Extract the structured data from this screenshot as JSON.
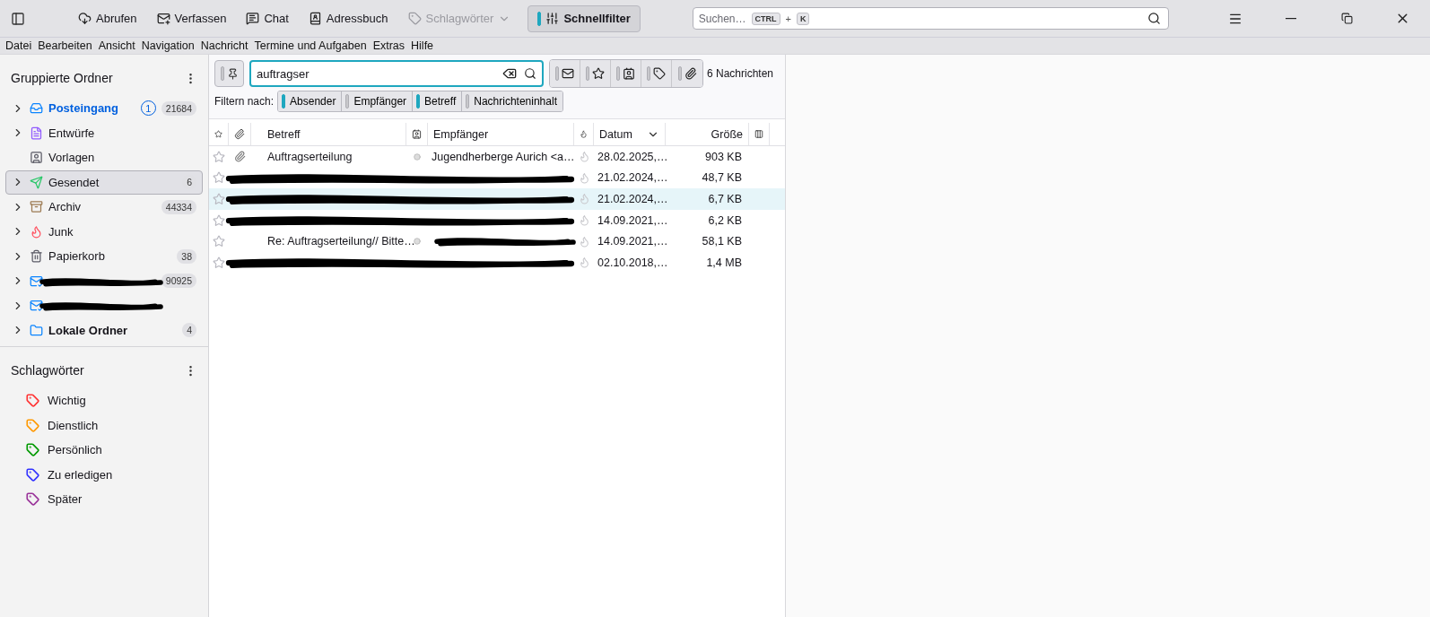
{
  "toolbar": {
    "buttons": [
      {
        "kind": "get",
        "label": "Abrufen",
        "selected": false,
        "disabled": false
      },
      {
        "kind": "write",
        "label": "Verfassen",
        "selected": false,
        "disabled": false
      },
      {
        "kind": "chat",
        "label": "Chat",
        "selected": false,
        "disabled": false
      },
      {
        "kind": "addressbook",
        "label": "Adressbuch",
        "selected": false,
        "disabled": false
      },
      {
        "kind": "tags",
        "label": "Schlagwörter",
        "selected": false,
        "disabled": true
      },
      {
        "kind": "quickfilter",
        "label": "Schnellfilter",
        "selected": true,
        "disabled": false
      }
    ],
    "search": {
      "placeholder": "Suchen…",
      "keys": [
        "CTRL",
        "+",
        "K"
      ]
    }
  },
  "menu_bar": [
    "Datei",
    "Bearbeiten",
    "Ansicht",
    "Navigation",
    "Nachricht",
    "Termine und Aufgaben",
    "Extras",
    "Hilfe"
  ],
  "folder_pane": {
    "title": "Gruppierte Ordner",
    "folders": [
      {
        "kind": "inbox",
        "name": "Posteingang",
        "redacted": false,
        "expandable": true,
        "selected": false,
        "unread": "1",
        "count": "21684"
      },
      {
        "kind": "drafts",
        "name": "Entwürfe",
        "redacted": false,
        "expandable": true,
        "selected": false
      },
      {
        "kind": "templates",
        "name": "Vorlagen",
        "redacted": false,
        "expandable": false,
        "selected": false
      },
      {
        "kind": "sent",
        "name": "Gesendet",
        "redacted": false,
        "expandable": true,
        "selected": true,
        "count": "6"
      },
      {
        "kind": "archive",
        "name": "Archiv",
        "redacted": false,
        "expandable": true,
        "selected": false,
        "count": "44334"
      },
      {
        "kind": "junk",
        "name": "Junk",
        "redacted": false,
        "expandable": true,
        "selected": false
      },
      {
        "kind": "trash",
        "name": "Papierkorb",
        "redacted": false,
        "expandable": true,
        "selected": false,
        "count": "38"
      },
      {
        "kind": "account",
        "redacted": true,
        "expandable": true,
        "selected": false,
        "count": "90925"
      },
      {
        "kind": "account",
        "redacted": true,
        "expandable": true,
        "selected": false
      },
      {
        "kind": "local",
        "name": "Lokale Ordner",
        "redacted": false,
        "expandable": true,
        "selected": false,
        "count": "4"
      }
    ],
    "tags_title": "Schlagwörter",
    "tags": [
      {
        "name": "Wichtig",
        "color": "#ff3333"
      },
      {
        "name": "Dienstlich",
        "color": "#ff9900"
      },
      {
        "name": "Persönlich",
        "color": "#009900"
      },
      {
        "name": "Zu erledigen",
        "color": "#3333ff"
      },
      {
        "name": "Später",
        "color": "#993399"
      }
    ]
  },
  "quick_filter": {
    "pinned": false,
    "value": "auftragser",
    "toggles": [
      {
        "kind": "unread",
        "on": false
      },
      {
        "kind": "starred",
        "on": false
      },
      {
        "kind": "contact",
        "on": false
      },
      {
        "kind": "tags",
        "on": false
      },
      {
        "kind": "attachment",
        "on": false
      }
    ],
    "count": "6 Nachrichten",
    "filter_label": "Filtern nach:",
    "filter_by": [
      {
        "label": "Absender",
        "on": true
      },
      {
        "label": "Empfänger",
        "on": false
      },
      {
        "label": "Betreff",
        "on": true
      },
      {
        "label": "Nachrichteninhalt",
        "on": false
      }
    ]
  },
  "table": {
    "columns": [
      {
        "kind": "star"
      },
      {
        "kind": "attachment"
      },
      {
        "kind": "text",
        "label": "Betreff"
      },
      {
        "kind": "correspondent"
      },
      {
        "kind": "text",
        "label": "Empfänger"
      },
      {
        "kind": "junk"
      },
      {
        "kind": "text",
        "label": "Datum",
        "sorted": true
      },
      {
        "kind": "size",
        "label": "Größe"
      },
      {
        "kind": "picker"
      }
    ],
    "rows": [
      {
        "starred": false,
        "attachment": true,
        "subject_redacted": false,
        "recipient_redacted": false,
        "subject": "Auftragserteilung",
        "recipient": "Jugendherberge Aurich <a…",
        "date": "28.02.2025,…",
        "size": "903 KB",
        "selected": false
      },
      {
        "starred": false,
        "attachment": false,
        "subject_redacted": true,
        "recipient_redacted": true,
        "date": "21.02.2024,…",
        "size": "48,7 KB",
        "selected": false
      },
      {
        "starred": false,
        "attachment": false,
        "subject_redacted": true,
        "recipient_redacted": true,
        "date": "21.02.2024,…",
        "size": "6,7 KB",
        "selected": true
      },
      {
        "starred": false,
        "attachment": false,
        "subject_redacted": true,
        "recipient_redacted": true,
        "date": "14.09.2021,…",
        "size": "6,2 KB",
        "selected": false
      },
      {
        "starred": false,
        "attachment": false,
        "subject_redacted": false,
        "recipient_redacted": true,
        "subject": "Re: Auftragserteilung// Bitte…",
        "date": "14.09.2021,…",
        "size": "58,1 KB",
        "selected": false
      },
      {
        "starred": false,
        "attachment": false,
        "subject_redacted": true,
        "recipient_redacted": true,
        "date": "02.10.2018,…",
        "size": "1,4 MB",
        "selected": false
      }
    ]
  }
}
